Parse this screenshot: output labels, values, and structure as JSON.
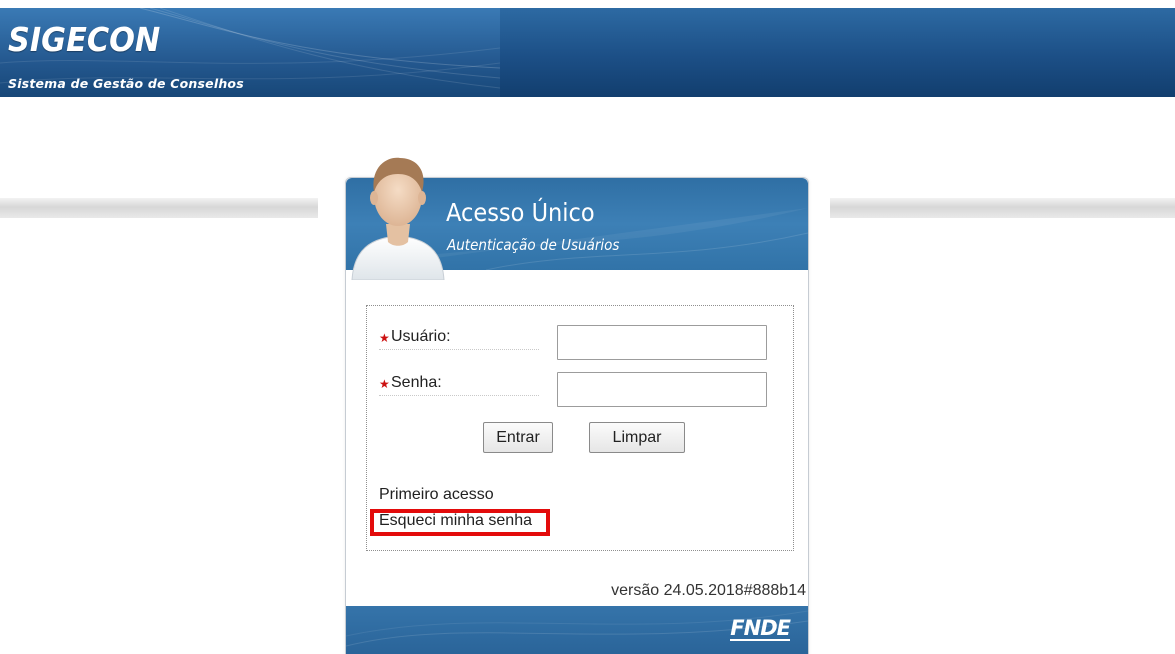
{
  "header": {
    "brand_title": "SIGECON",
    "brand_subtitle": "Sistema de Gestão de Conselhos"
  },
  "login": {
    "title": "Acesso Único",
    "subtitle": "Autenticação de Usuários",
    "user_label": "Usuário:",
    "user_value": "",
    "password_label": "Senha:",
    "password_value": "",
    "required_marker": "★",
    "enter_button": "Entrar",
    "clear_button": "Limpar",
    "first_access_link": "Primeiro acesso",
    "forgot_password_link": "Esqueci minha senha",
    "version": "versão 24.05.2018#888b14",
    "footer_logo": "FNDE"
  },
  "colors": {
    "header_blue": "#1c4f86",
    "card_blue": "#3173a8",
    "highlight_red": "#e30b0b",
    "required_red": "#cc1111"
  },
  "icons": {
    "avatar": "user-avatar-icon"
  }
}
